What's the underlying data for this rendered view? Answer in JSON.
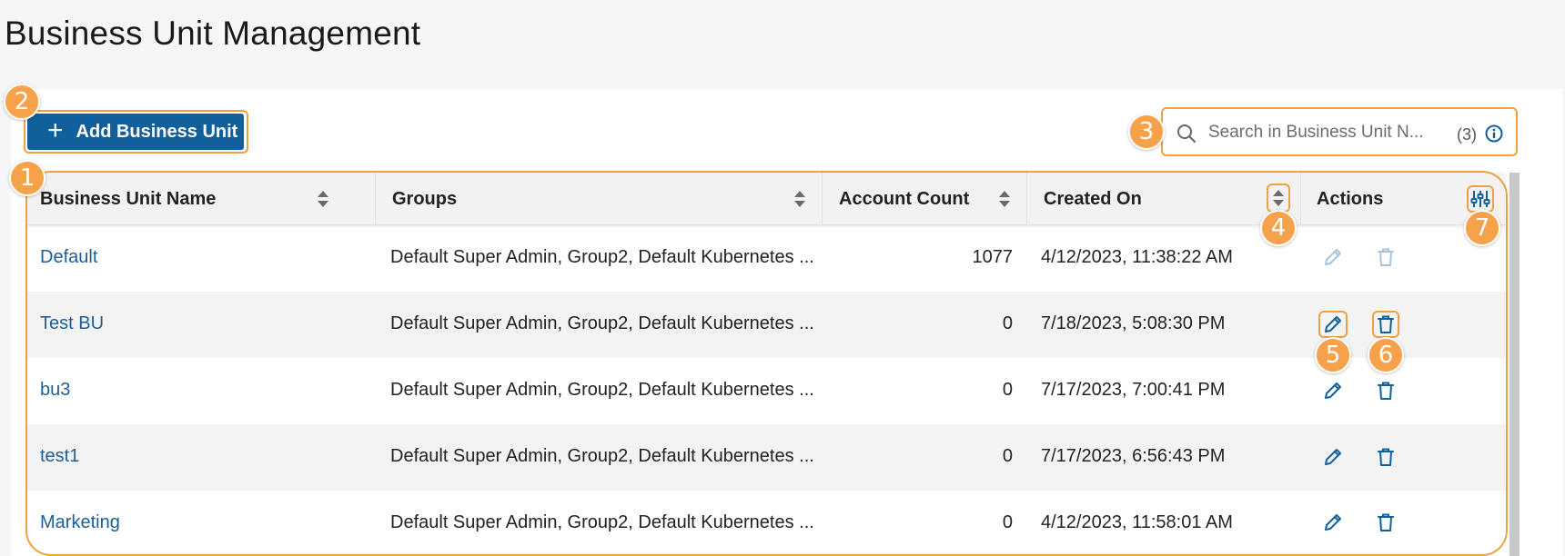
{
  "page": {
    "title": "Business Unit Management"
  },
  "toolbar": {
    "add_label": "Add Business Unit",
    "add_icon": "plus-icon"
  },
  "search": {
    "placeholder": "Search in Business Unit N...",
    "count": "(3)"
  },
  "table": {
    "columns": {
      "name": "Business Unit Name",
      "groups": "Groups",
      "account_count": "Account Count",
      "created_on": "Created On",
      "actions": "Actions"
    },
    "rows": [
      {
        "name": "Default",
        "groups": "Default Super Admin, Group2, Default Kubernetes ...",
        "account_count": "1077",
        "created_on": "4/12/2023, 11:38:22 AM",
        "actions_enabled": false
      },
      {
        "name": "Test BU",
        "groups": "Default Super Admin, Group2, Default Kubernetes ...",
        "account_count": "0",
        "created_on": "7/18/2023, 5:08:30 PM",
        "actions_enabled": true
      },
      {
        "name": "bu3",
        "groups": "Default Super Admin, Group2, Default Kubernetes ...",
        "account_count": "0",
        "created_on": "7/17/2023, 7:00:41 PM",
        "actions_enabled": true
      },
      {
        "name": "test1",
        "groups": "Default Super Admin, Group2, Default Kubernetes ...",
        "account_count": "0",
        "created_on": "7/17/2023, 6:56:43 PM",
        "actions_enabled": true
      },
      {
        "name": "Marketing",
        "groups": "Default Super Admin, Group2, Default Kubernetes ...",
        "account_count": "0",
        "created_on": "4/12/2023, 11:58:01 AM",
        "actions_enabled": true
      }
    ]
  },
  "callouts": [
    "1",
    "2",
    "3",
    "4",
    "5",
    "6",
    "7"
  ],
  "colors": {
    "accent": "#11609c",
    "link": "#1d5e96",
    "callout": "#f5a24a",
    "icon_disabled": "#a9c4dc"
  }
}
